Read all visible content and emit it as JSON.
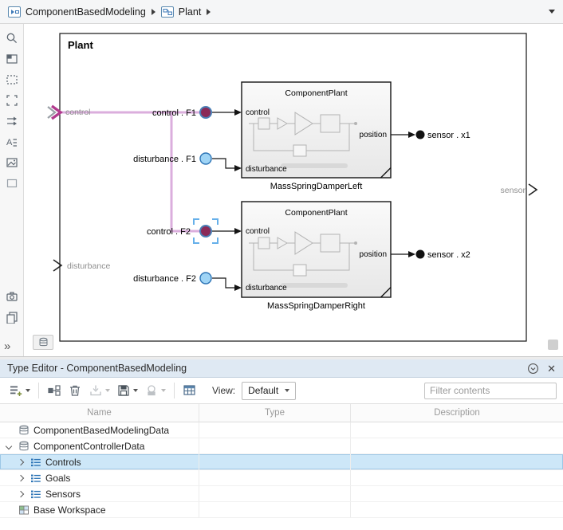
{
  "colors": {
    "selection_blue": "#cde7f8",
    "highlight_pink": "#dbaedd",
    "control_port_fill": "#8a2a58",
    "disturbance_port_fill": "#9fd4f5",
    "titlebar_blue": "#dfe9f3"
  },
  "breadcrumb": {
    "items": [
      {
        "label": "ComponentBasedModeling"
      },
      {
        "label": "Plant"
      }
    ]
  },
  "plant": {
    "title": "Plant",
    "input_ports": [
      {
        "label": "control"
      },
      {
        "label": "disturbance"
      }
    ],
    "output_ports": [
      {
        "label": "sensor"
      }
    ],
    "blocks": [
      {
        "inner_title": "ComponentPlant",
        "name": "MassSpringDamperLeft",
        "ports": {
          "in1": "control",
          "in2": "disturbance",
          "out1": "position"
        }
      },
      {
        "inner_title": "ComponentPlant",
        "name": "MassSpringDamperRight",
        "ports": {
          "in1": "control",
          "in2": "disturbance",
          "out1": "position"
        }
      }
    ],
    "bus_ports": {
      "control_f1": "control . F1",
      "disturbance_f1": "disturbance . F1",
      "sensor_x1": "sensor . x1",
      "control_f2": "control . F2",
      "disturbance_f2": "disturbance . F2",
      "sensor_x2": "sensor . x2"
    }
  },
  "left_toolbar": {
    "icons": [
      "zoom",
      "viewport",
      "comment-box",
      "selection-frame",
      "signal-routing",
      "annotation",
      "image",
      "area",
      "camera",
      "copy"
    ],
    "more_glyph": "»"
  },
  "type_editor": {
    "title": "Type Editor - ComponentBasedModeling",
    "toolbar": {
      "icons": [
        "add-type",
        "hierarchy",
        "delete",
        "import",
        "save",
        "apply",
        "new-table"
      ],
      "view_label": "View:",
      "view_value": "Default",
      "filter_placeholder": "Filter contents"
    },
    "table": {
      "columns": [
        "Name",
        "Type",
        "Description"
      ],
      "rows": [
        {
          "name": "ComponentBasedModelingData",
          "type": "",
          "description": ""
        },
        {
          "name": "ComponentControllerData",
          "type": "",
          "description": ""
        },
        {
          "name": "Controls",
          "type": "",
          "description": ""
        },
        {
          "name": "Goals",
          "type": "",
          "description": ""
        },
        {
          "name": "Sensors",
          "type": "",
          "description": ""
        },
        {
          "name": "Base Workspace",
          "type": "",
          "description": ""
        }
      ]
    }
  }
}
